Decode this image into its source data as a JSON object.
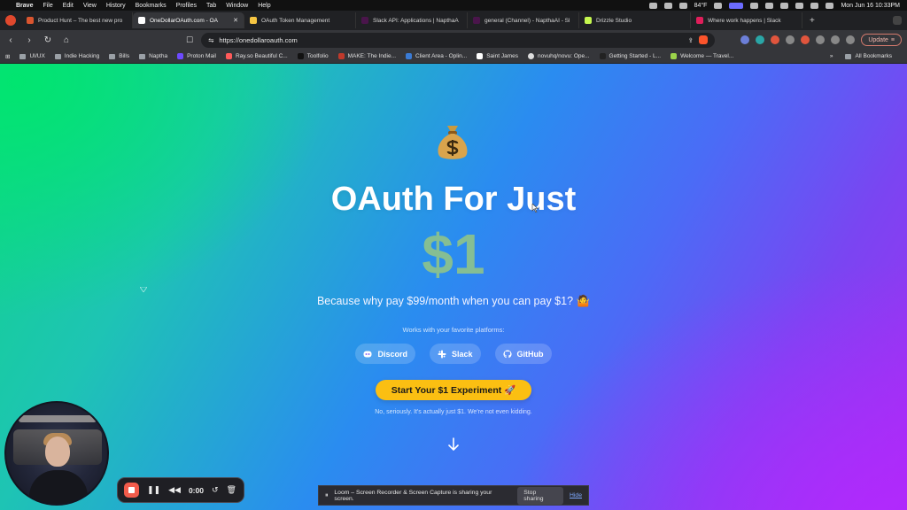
{
  "menubar": {
    "app": "Brave",
    "items": [
      "File",
      "Edit",
      "View",
      "History",
      "Bookmarks",
      "Profiles",
      "Tab",
      "Window",
      "Help"
    ],
    "temperature": "84°F",
    "datetime": "Mon Jun 16  10:33PM"
  },
  "tabs": [
    {
      "title": "Product Hunt – The best new pro",
      "color": "#da552f",
      "active": false
    },
    {
      "title": "OneDollarOAuth.com - OA",
      "color": "#ffffff",
      "active": true
    },
    {
      "title": "OAuth Token Management",
      "color": "#f5c542",
      "active": false
    },
    {
      "title": "Slack API: Applications | NapthaA",
      "color": "#4a154b",
      "active": false
    },
    {
      "title": "general (Channel) - NapthaAI - Sl",
      "color": "#4a154b",
      "active": false
    },
    {
      "title": "Drizzle Studio",
      "color": "#c5f74f",
      "active": false
    },
    {
      "title": "Where work happens | Slack",
      "color": "#e01e5a",
      "active": false
    }
  ],
  "address": {
    "url": "https://onedollaroauth.com",
    "update_label": "Update"
  },
  "bookmarks": [
    {
      "label": "UI/UX",
      "type": "folder"
    },
    {
      "label": "Indie Hacking",
      "type": "folder"
    },
    {
      "label": "Bills",
      "type": "folder"
    },
    {
      "label": "Naptha",
      "type": "folder"
    },
    {
      "label": "Proton Mail",
      "type": "site"
    },
    {
      "label": "Ray.so Beautiful C...",
      "type": "site"
    },
    {
      "label": "Toolfolio",
      "type": "site"
    },
    {
      "label": "MAKE: The Indie...",
      "type": "site"
    },
    {
      "label": "Client Area - Oplin...",
      "type": "site"
    },
    {
      "label": "Saint James",
      "type": "site"
    },
    {
      "label": "novuhq/novu: Ope...",
      "type": "site"
    },
    {
      "label": "Getting Started - L...",
      "type": "site"
    },
    {
      "label": "Welcome — Travel...",
      "type": "site"
    }
  ],
  "bookmarks_more": "»",
  "bookmarks_all": "All Bookmarks",
  "hero": {
    "emoji": "💰",
    "headline": "OAuth For Just",
    "price": "$1",
    "subtitle": "Because why pay $99/month when you can pay $1? 🤷",
    "works_with": "Works with your favorite platforms:",
    "platforms": [
      "Discord",
      "Slack",
      "GitHub"
    ],
    "cta": "Start Your $1 Experiment 🚀",
    "fineprint": "No, seriously. It's actually just $1. We're not even kidding."
  },
  "loom": {
    "time": "0:00",
    "share_text": "Loom – Screen Recorder & Screen Capture is sharing your screen.",
    "stop_label": "Stop sharing",
    "hide_label": "Hide"
  }
}
